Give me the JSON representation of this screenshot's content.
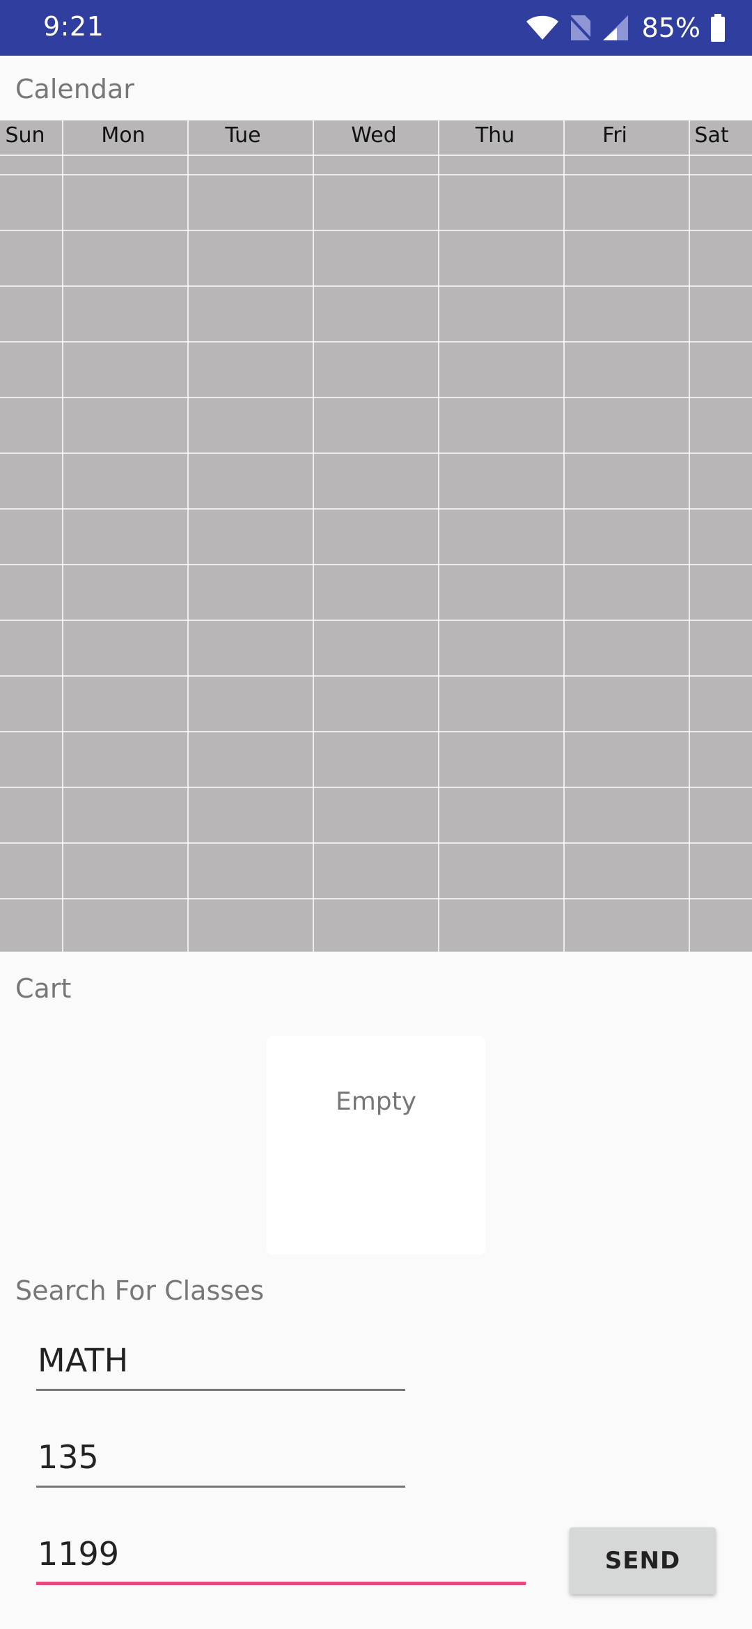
{
  "status_bar": {
    "time": "9:21",
    "battery_percent": "85%",
    "icons": [
      "wifi-icon",
      "no-sim-icon",
      "cell-signal-icon",
      "battery-icon"
    ]
  },
  "calendar": {
    "title": "Calendar",
    "days": [
      "Sun",
      "Mon",
      "Tue",
      "Wed",
      "Thu",
      "Fri",
      "Sat"
    ]
  },
  "cart": {
    "title": "Cart",
    "empty_label": "Empty"
  },
  "search": {
    "title": "Search For Classes",
    "subject_value": "MATH",
    "course_value": "135",
    "term_value": "1199",
    "send_label": "SEND"
  },
  "colors": {
    "status_bar": "#303f9f",
    "calendar_bg": "#b8b6b7",
    "active_underline": "#e84a7d"
  }
}
